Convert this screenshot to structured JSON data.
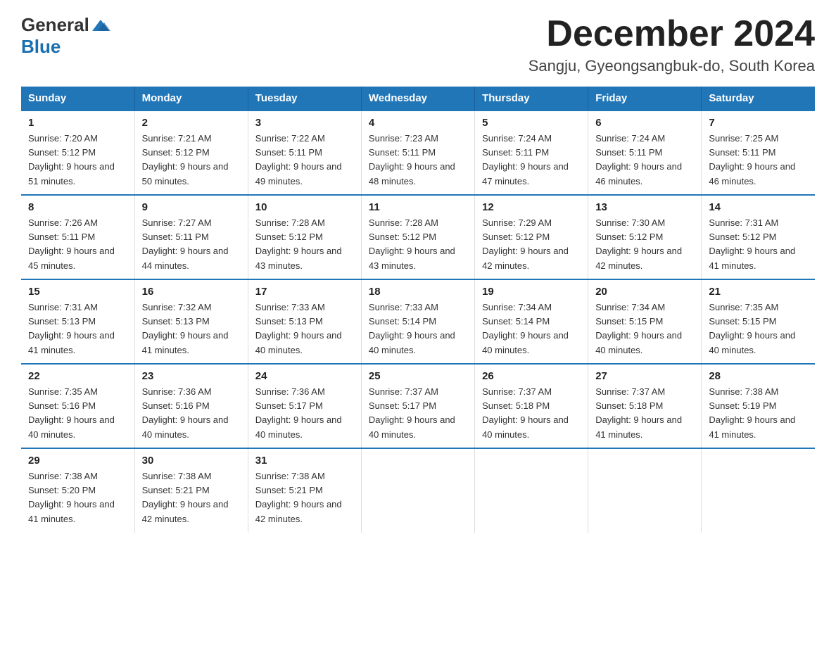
{
  "logo": {
    "text_general": "General",
    "text_blue": "Blue",
    "icon_alt": "GeneralBlue logo"
  },
  "title": "December 2024",
  "subtitle": "Sangju, Gyeongsangbuk-do, South Korea",
  "header": {
    "colors": {
      "accent": "#2176b8"
    },
    "days": [
      "Sunday",
      "Monday",
      "Tuesday",
      "Wednesday",
      "Thursday",
      "Friday",
      "Saturday"
    ]
  },
  "weeks": [
    [
      {
        "day": "1",
        "sunrise": "7:20 AM",
        "sunset": "5:12 PM",
        "daylight": "9 hours and 51 minutes."
      },
      {
        "day": "2",
        "sunrise": "7:21 AM",
        "sunset": "5:12 PM",
        "daylight": "9 hours and 50 minutes."
      },
      {
        "day": "3",
        "sunrise": "7:22 AM",
        "sunset": "5:11 PM",
        "daylight": "9 hours and 49 minutes."
      },
      {
        "day": "4",
        "sunrise": "7:23 AM",
        "sunset": "5:11 PM",
        "daylight": "9 hours and 48 minutes."
      },
      {
        "day": "5",
        "sunrise": "7:24 AM",
        "sunset": "5:11 PM",
        "daylight": "9 hours and 47 minutes."
      },
      {
        "day": "6",
        "sunrise": "7:24 AM",
        "sunset": "5:11 PM",
        "daylight": "9 hours and 46 minutes."
      },
      {
        "day": "7",
        "sunrise": "7:25 AM",
        "sunset": "5:11 PM",
        "daylight": "9 hours and 46 minutes."
      }
    ],
    [
      {
        "day": "8",
        "sunrise": "7:26 AM",
        "sunset": "5:11 PM",
        "daylight": "9 hours and 45 minutes."
      },
      {
        "day": "9",
        "sunrise": "7:27 AM",
        "sunset": "5:11 PM",
        "daylight": "9 hours and 44 minutes."
      },
      {
        "day": "10",
        "sunrise": "7:28 AM",
        "sunset": "5:12 PM",
        "daylight": "9 hours and 43 minutes."
      },
      {
        "day": "11",
        "sunrise": "7:28 AM",
        "sunset": "5:12 PM",
        "daylight": "9 hours and 43 minutes."
      },
      {
        "day": "12",
        "sunrise": "7:29 AM",
        "sunset": "5:12 PM",
        "daylight": "9 hours and 42 minutes."
      },
      {
        "day": "13",
        "sunrise": "7:30 AM",
        "sunset": "5:12 PM",
        "daylight": "9 hours and 42 minutes."
      },
      {
        "day": "14",
        "sunrise": "7:31 AM",
        "sunset": "5:12 PM",
        "daylight": "9 hours and 41 minutes."
      }
    ],
    [
      {
        "day": "15",
        "sunrise": "7:31 AM",
        "sunset": "5:13 PM",
        "daylight": "9 hours and 41 minutes."
      },
      {
        "day": "16",
        "sunrise": "7:32 AM",
        "sunset": "5:13 PM",
        "daylight": "9 hours and 41 minutes."
      },
      {
        "day": "17",
        "sunrise": "7:33 AM",
        "sunset": "5:13 PM",
        "daylight": "9 hours and 40 minutes."
      },
      {
        "day": "18",
        "sunrise": "7:33 AM",
        "sunset": "5:14 PM",
        "daylight": "9 hours and 40 minutes."
      },
      {
        "day": "19",
        "sunrise": "7:34 AM",
        "sunset": "5:14 PM",
        "daylight": "9 hours and 40 minutes."
      },
      {
        "day": "20",
        "sunrise": "7:34 AM",
        "sunset": "5:15 PM",
        "daylight": "9 hours and 40 minutes."
      },
      {
        "day": "21",
        "sunrise": "7:35 AM",
        "sunset": "5:15 PM",
        "daylight": "9 hours and 40 minutes."
      }
    ],
    [
      {
        "day": "22",
        "sunrise": "7:35 AM",
        "sunset": "5:16 PM",
        "daylight": "9 hours and 40 minutes."
      },
      {
        "day": "23",
        "sunrise": "7:36 AM",
        "sunset": "5:16 PM",
        "daylight": "9 hours and 40 minutes."
      },
      {
        "day": "24",
        "sunrise": "7:36 AM",
        "sunset": "5:17 PM",
        "daylight": "9 hours and 40 minutes."
      },
      {
        "day": "25",
        "sunrise": "7:37 AM",
        "sunset": "5:17 PM",
        "daylight": "9 hours and 40 minutes."
      },
      {
        "day": "26",
        "sunrise": "7:37 AM",
        "sunset": "5:18 PM",
        "daylight": "9 hours and 40 minutes."
      },
      {
        "day": "27",
        "sunrise": "7:37 AM",
        "sunset": "5:18 PM",
        "daylight": "9 hours and 41 minutes."
      },
      {
        "day": "28",
        "sunrise": "7:38 AM",
        "sunset": "5:19 PM",
        "daylight": "9 hours and 41 minutes."
      }
    ],
    [
      {
        "day": "29",
        "sunrise": "7:38 AM",
        "sunset": "5:20 PM",
        "daylight": "9 hours and 41 minutes."
      },
      {
        "day": "30",
        "sunrise": "7:38 AM",
        "sunset": "5:21 PM",
        "daylight": "9 hours and 42 minutes."
      },
      {
        "day": "31",
        "sunrise": "7:38 AM",
        "sunset": "5:21 PM",
        "daylight": "9 hours and 42 minutes."
      },
      null,
      null,
      null,
      null
    ]
  ]
}
